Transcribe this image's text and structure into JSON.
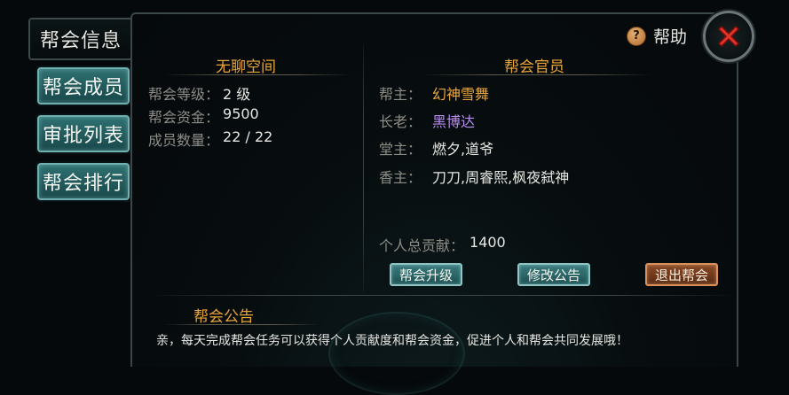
{
  "sidebar": {
    "tabs": [
      {
        "label": "帮会信息"
      },
      {
        "label": "帮会成员"
      },
      {
        "label": "审批列表"
      },
      {
        "label": "帮会排行"
      }
    ]
  },
  "header": {
    "help_label": "帮助"
  },
  "guild_info": {
    "name": "无聊空间",
    "level_label": "帮会等级：",
    "level_value": "2 级",
    "funds_label": "帮会资金：",
    "funds_value": "9500",
    "members_label": "成员数量：",
    "members_value": "22 / 22"
  },
  "officials": {
    "title": "帮会官员",
    "leader_label": "帮主：",
    "leader_value": "幻神雪舞",
    "elder_label": "长老：",
    "elder_value": "黑博达",
    "hall_label": "堂主：",
    "hall_value": "燃夕,道爷",
    "incense_label": "香主：",
    "incense_value": "刀刀,周睿熙,枫夜弑神",
    "contribution_label": "个人总贡献：",
    "contribution_value": "1400"
  },
  "buttons": {
    "upgrade": "帮会升级",
    "edit_notice": "修改公告",
    "leave": "退出帮会"
  },
  "notice": {
    "title": "帮会公告",
    "text": "亲，每天完成帮会任务可以获得个人贡献度和帮会资金，促进个人和帮会共同发展哦！"
  },
  "colors": {
    "title_orange": "#e8a53a",
    "leader_gold": "#e8a53a",
    "elder_purple": "#b98cf0",
    "teal_button": "#2f6f71",
    "orange_button": "#7a3d1e",
    "close_red": "#e0352a"
  },
  "icons": {
    "help": "help-question-icon",
    "close": "close-x-icon"
  }
}
